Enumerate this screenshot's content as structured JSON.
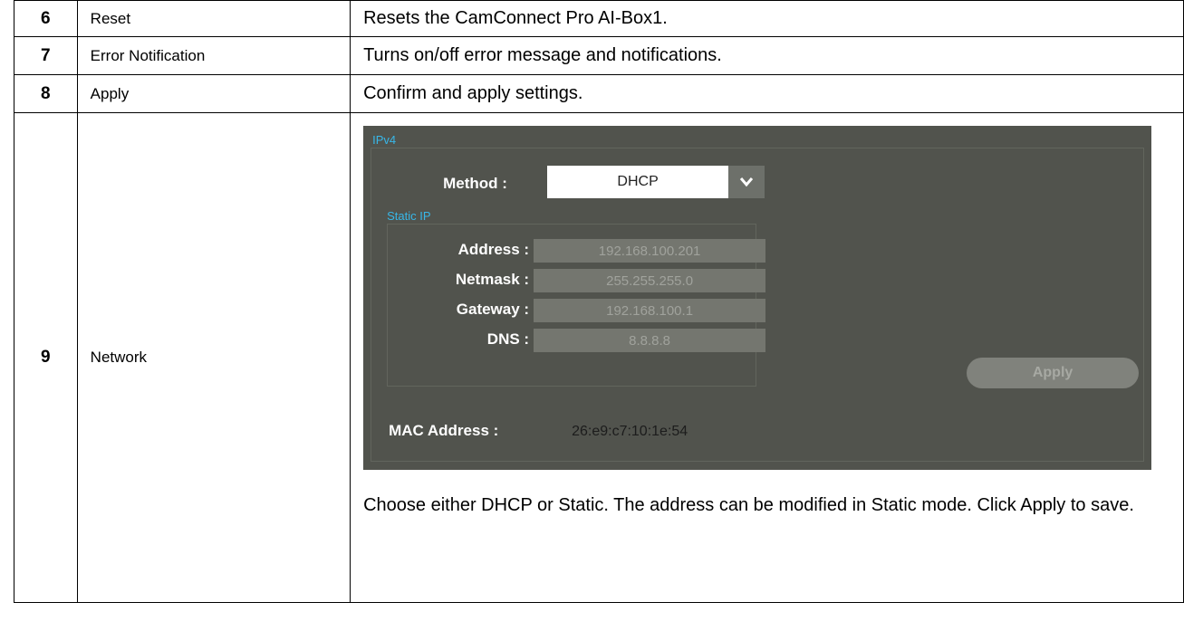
{
  "rows": [
    {
      "num": "6",
      "name": "Reset",
      "desc": "Resets the CamConnect Pro AI-Box1."
    },
    {
      "num": "7",
      "name": "Error Notification",
      "desc": "Turns on/off error message and notifications."
    },
    {
      "num": "8",
      "name": "Apply",
      "desc": "Confirm and apply settings."
    },
    {
      "num": "9",
      "name": "Network",
      "caption": "Choose either DHCP or Static. The address can be modified in Static mode. Click Apply to save."
    }
  ],
  "network_panel": {
    "section_title": "IPv4",
    "method_label": "Method :",
    "method_value": "DHCP",
    "static_title": "Static IP",
    "address_label": "Address :",
    "address_value": "192.168.100.201",
    "netmask_label": "Netmask :",
    "netmask_value": "255.255.255.0",
    "gateway_label": "Gateway :",
    "gateway_value": "192.168.100.1",
    "dns_label": "DNS :",
    "dns_value": "8.8.8.8",
    "apply_label": "Apply",
    "mac_label": "MAC Address :",
    "mac_value": "26:e9:c7:10:1e:54"
  },
  "colors": {
    "panel_bg": "#51534d",
    "legend": "#38b7e8",
    "input_bg": "#74766f",
    "input_text": "#a0a29c",
    "button_bg": "#80827c"
  },
  "icons": {
    "dropdown": "chevron-down-icon"
  }
}
